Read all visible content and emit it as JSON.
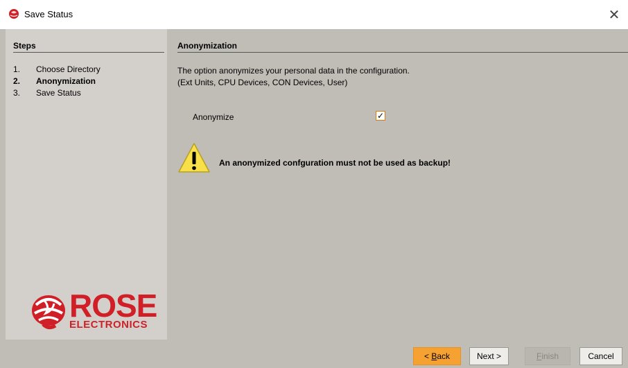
{
  "window": {
    "title": "Save Status",
    "close_glyph": "✕"
  },
  "steps": {
    "header": "Steps",
    "items": [
      {
        "num": "1.",
        "label": "Choose Directory",
        "active": false
      },
      {
        "num": "2.",
        "label": "Anonymization",
        "active": true
      },
      {
        "num": "3.",
        "label": "Save Status",
        "active": false
      }
    ]
  },
  "logo": {
    "word": "ROSE",
    "sub": "ELECTRONICS",
    "color": "#d01f27"
  },
  "content": {
    "title": "Anonymization",
    "desc_line1": "The option anonymizes your personal data in the configuration.",
    "desc_line2": "(Ext Units, CPU Devices, CON Devices, User)",
    "option_label": "Anonymize",
    "option_checked": true,
    "check_glyph": "✓",
    "warning": "An anonymized confguration must not be used as backup!"
  },
  "buttons": {
    "back_prefix": "< ",
    "back_mnemonic": "B",
    "back_rest": "ack",
    "next": "Next >",
    "finish_mnemonic": "F",
    "finish_rest": "inish",
    "cancel": "Cancel"
  },
  "colors": {
    "dialog_bg": "#c0bcb6",
    "sidebar_bg": "#d3d0cc",
    "accent_orange": "#f6a233"
  }
}
